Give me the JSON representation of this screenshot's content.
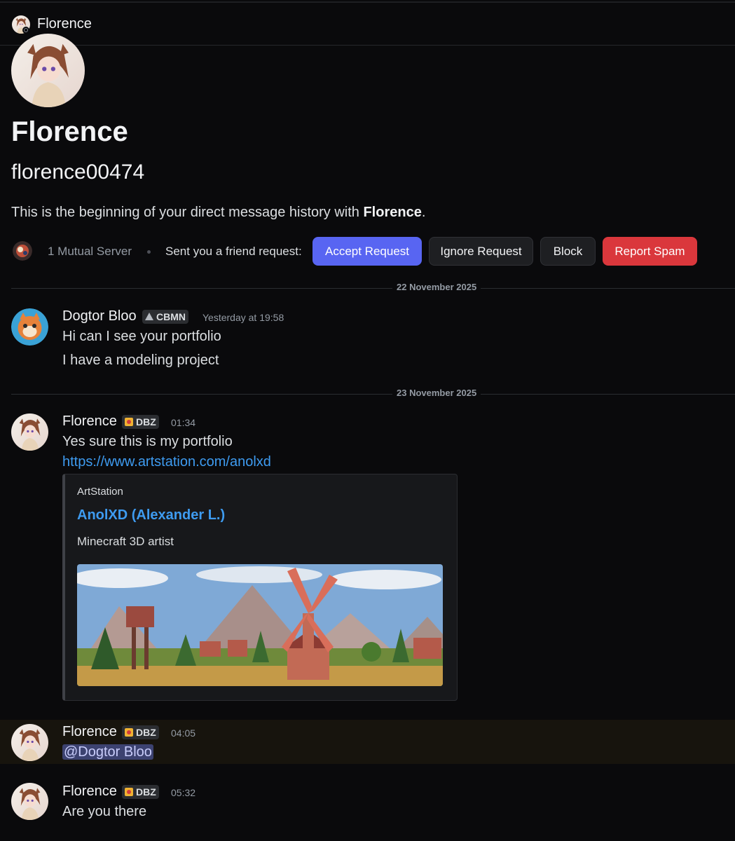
{
  "header": {
    "name": "Florence"
  },
  "profile": {
    "display_name": "Florence",
    "username": "florence00474",
    "intro_prefix": "This is the beginning of your direct message history with ",
    "intro_name": "Florence",
    "intro_suffix": "."
  },
  "mutual": {
    "servers": "1 Mutual Server",
    "request_text": "Sent you a friend request:",
    "accept": "Accept Request",
    "ignore": "Ignore Request",
    "block": "Block",
    "report": "Report Spam"
  },
  "dividers": [
    "22 November 2025",
    "23 November 2025"
  ],
  "messages": [
    {
      "author": "Dogtor Bloo",
      "tag": "CBMN",
      "time": "Yesterday at 19:58",
      "lines": [
        "Hi can I see your portfolio",
        "I have a modeling project"
      ]
    },
    {
      "author": "Florence",
      "tag": "DBZ",
      "time": "01:34",
      "lines": [
        "Yes sure this is my portfolio"
      ],
      "link": "https://www.artstation.com/anolxd",
      "embed": {
        "provider": "ArtStation",
        "title": "AnolXD (Alexander L.)",
        "description": "Minecraft 3D artist"
      }
    },
    {
      "author": "Florence",
      "tag": "DBZ",
      "time": "04:05",
      "mention": "@Dogtor Bloo"
    },
    {
      "author": "Florence",
      "tag": "DBZ",
      "time": "05:32",
      "lines": [
        "Are you there"
      ]
    }
  ],
  "colors": {
    "accent": "#5865f2",
    "danger": "#da373c",
    "link": "#3e9bf0",
    "background": "#0a0a0c"
  }
}
